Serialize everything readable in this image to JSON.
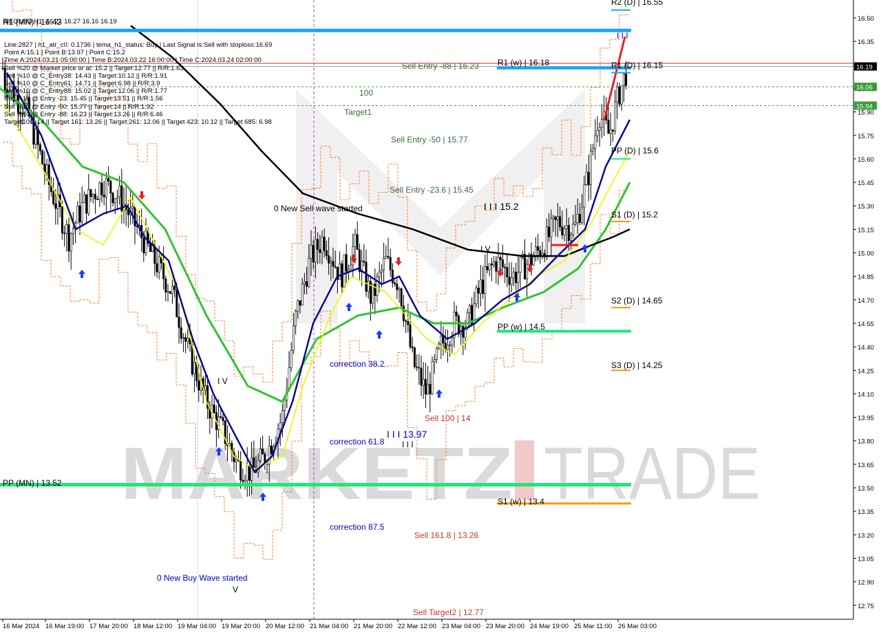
{
  "chart_data": {
    "type": "candlestick",
    "symbol": "NEOUSD",
    "timeframe": "H1",
    "header": "NEOUSD,H1  16.21 16.27 16.16 16.19",
    "info_lines": [
      "Line:2827 | h1_atr_c0: 0.1736 | tema_h1_status: Buy | Last Signal is:Sell with stoploss:16.69",
      "Point A:15.1 | Point B:13.97 | Point C:15.2",
      "Time A:2024.03.21 05:00:00 | Time B:2024.03.22 16:00:00 | Time C:2024.03.24 02:00:00",
      "Sell %20 @ Market price or at: 15.2 || Target:12.77 || R/R:1.63",
      "Sell %10 @ C_Entry38: 14.43 || Target:10.12 || R/R:1.91",
      "Sell %10 @ C_Entry61: 14.71 || Target:6.98 || R/R:3.9",
      "Sell %10 @ C_Entry88: 15.02 || Target:12.06 || R/R:1.77",
      "Sell %10 @ Entry -23: 15.45 || Target:13.51 || R/R:1.56",
      "Sell %10 @ Entry -50: 15.77 || Target:14 || R/R:1.92",
      "Sell %10 @ Entry -88: 16.23 || Target:13.26 || R/R:6.46",
      "Target100: 14 || Target 161: 13.26 || Target 261: 12.06 || Target 423: 10.12 || Target 685: 6.98"
    ],
    "y_ticks": [
      "16.50",
      "16.35",
      "16.20",
      "16.05",
      "15.90",
      "15.75",
      "15.60",
      "15.45",
      "15.30",
      "15.15",
      "15.00",
      "14.85",
      "14.70",
      "14.55",
      "14.40",
      "14.25",
      "14.10",
      "13.95",
      "13.80",
      "13.65",
      "13.50",
      "13.35",
      "13.20",
      "13.05",
      "12.90",
      "12.75"
    ],
    "x_labels": [
      "16 Mar 2024",
      "16 Mar 19:00",
      "17 Mar 20:00",
      "18 Mar 12:00",
      "19 Mar 04:00",
      "19 Mar 20:00",
      "20 Mar 12:00",
      "21 Mar 04:00",
      "21 Mar 20:00",
      "22 Mar 12:00",
      "23 Mar 04:00",
      "23 Mar 20:00",
      "24 Mar 19:00",
      "25 Mar 11:00",
      "26 Mar 03:00"
    ],
    "price_tags": [
      {
        "label": "16.19",
        "value": 16.19,
        "color": "#000000"
      },
      {
        "label": "16.06",
        "value": 16.06,
        "color": "#3a9a3a"
      },
      {
        "label": "15.94",
        "value": 15.94,
        "color": "#3a9a3a"
      }
    ],
    "watermark": "MARKETZITRADE",
    "levels": [
      {
        "label": "R1 (MN) | 16.42",
        "value": 16.42
      },
      {
        "label": "R1 (w) | 16.18",
        "value": 16.18
      },
      {
        "label": "R2 (D) | 16.55",
        "value": 16.55
      },
      {
        "label": "R1 (D) | 16.15",
        "value": 16.15
      },
      {
        "label": "PP (D) | 15.6",
        "value": 15.6
      },
      {
        "label": "S1 (D) | 15.2",
        "value": 15.2
      },
      {
        "label": "S2 (D) | 14.65",
        "value": 14.65
      },
      {
        "label": "S3 (D) | 14.25",
        "value": 14.25
      },
      {
        "label": "PP (w) | 14.5",
        "value": 14.5
      },
      {
        "label": "PP (MN) | 13.52",
        "value": 13.52
      },
      {
        "label": "S1 (w) | 13.4",
        "value": 13.4
      }
    ],
    "annotations": [
      "Sell Entry -88 | 16.23",
      "100",
      "Target1",
      "Sell Entry -50 | 15.77",
      "Sell Entry -23.6 | 15.45",
      "0 New Sell wave started",
      "I I I 15.2",
      "I V",
      "correction 38.2",
      "correction 61.8",
      "correction 87.5",
      "I I I 13.97",
      "Sell 100 | 14",
      "Sell 161.8 | 13.26",
      "Sell Target2 | 12.77",
      "0 New Buy Wave started",
      "I I I",
      "I V",
      "V",
      "I I I"
    ],
    "colors": {
      "ma_black": "#000000",
      "ma_green": "#2ec42e",
      "ma_navy": "#0a0a8c",
      "ma_yellow": "#f2f200",
      "envelope": "#ff6a1a",
      "pivot_blue": "#1aa3ff",
      "pivot_green": "#1ee67a",
      "pivot_orange": "#ff9900",
      "sell_text": "#c0392b",
      "buy_text": "#0000cc",
      "entry_text": "#3a6b3a",
      "watermark_grey": "#dadada",
      "watermark_red": "#f2c8c8"
    }
  }
}
